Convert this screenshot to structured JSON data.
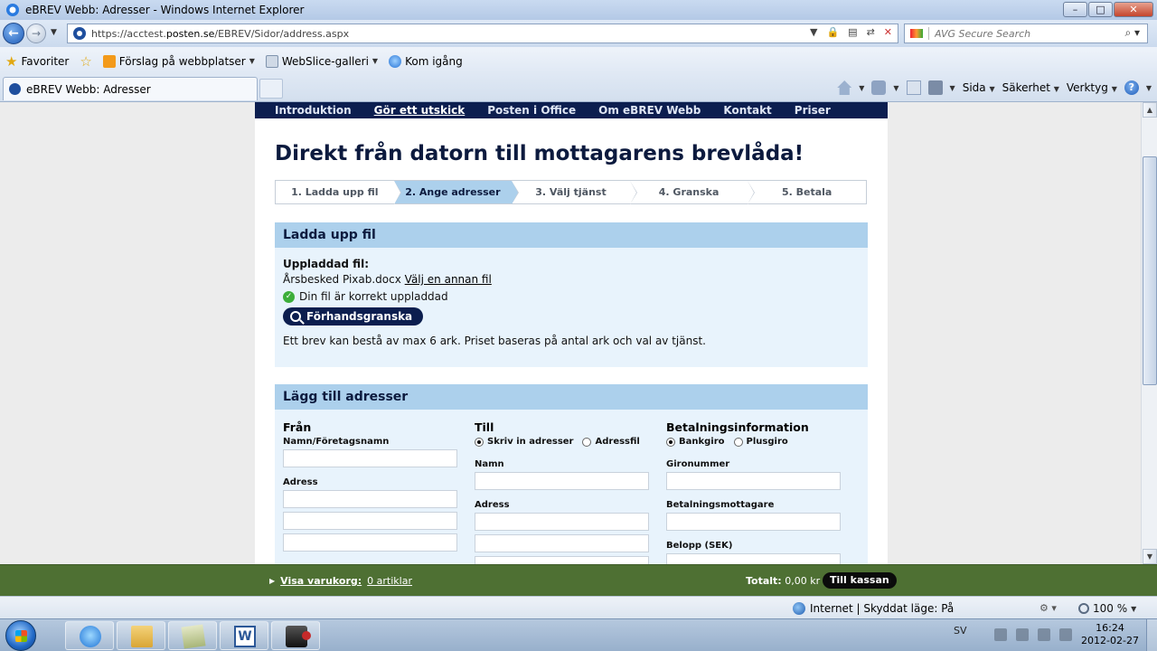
{
  "window": {
    "title": "eBREV Webb: Adresser - Windows Internet Explorer"
  },
  "addressbar": {
    "url_prefix": "https://acctest.",
    "url_domain": "posten.se",
    "url_suffix": "/EBREV/Sidor/address.aspx",
    "search_placeholder": "AVG Secure Search"
  },
  "favorites": {
    "favorites_label": "Favoriter",
    "items": [
      {
        "label": "Förslag på webbplatser"
      },
      {
        "label": "WebSlice-galleri"
      },
      {
        "label": "Kom igång"
      }
    ]
  },
  "tabs": [
    {
      "label": "eBREV Webb: Adresser"
    }
  ],
  "commandbar": {
    "page": "Sida",
    "safety": "Säkerhet",
    "tools": "Verktyg"
  },
  "site": {
    "nav": [
      "Introduktion",
      "Gör ett utskick",
      "Posten i Office",
      "Om eBREV Webb",
      "Kontakt",
      "Priser"
    ],
    "active_nav_index": 1,
    "headline": "Direkt från datorn till mottagarens brevlåda!",
    "steps": [
      "1. Ladda upp fil",
      "2. Ange adresser",
      "3. Välj tjänst",
      "4. Granska",
      "5. Betala"
    ],
    "active_step_index": 1,
    "upload": {
      "title": "Ladda upp fil",
      "uploaded_label": "Uppladdad fil:",
      "filename": "Årsbesked Pixab.docx",
      "change_link": "Välj en annan fil",
      "ok_message": "Din fil är korrekt uppladdad",
      "preview_button": "Förhandsgranska",
      "info": "Ett brev kan bestå av max 6 ark. Priset baseras på antal ark och val av tjänst."
    },
    "addresses": {
      "title": "Lägg till adresser",
      "from": {
        "heading": "Från",
        "name_label": "Namn/Företagsnamn",
        "address_label": "Adress"
      },
      "to": {
        "heading": "Till",
        "radio_manual": "Skriv in adresser",
        "radio_file": "Adressfil",
        "name_label": "Namn",
        "address_label": "Adress"
      },
      "payment": {
        "heading": "Betalningsinformation",
        "radio_bankgiro": "Bankgiro",
        "radio_plusgiro": "Plusgiro",
        "account_label": "Gironummer",
        "recipient_label": "Betalningsmottagare",
        "amount_label": "Belopp (SEK)"
      }
    }
  },
  "cart": {
    "link_label": "Visa varukorg:",
    "count": "0 artiklar",
    "total_label": "Totalt:",
    "total_value": "0,00 kr",
    "checkout": "Till kassan"
  },
  "status": {
    "zone": "Internet | Skyddat läge: På",
    "zoom": "100 %"
  },
  "taskbar": {
    "lang": "SV",
    "time": "16:24",
    "date": "2012-02-27"
  }
}
